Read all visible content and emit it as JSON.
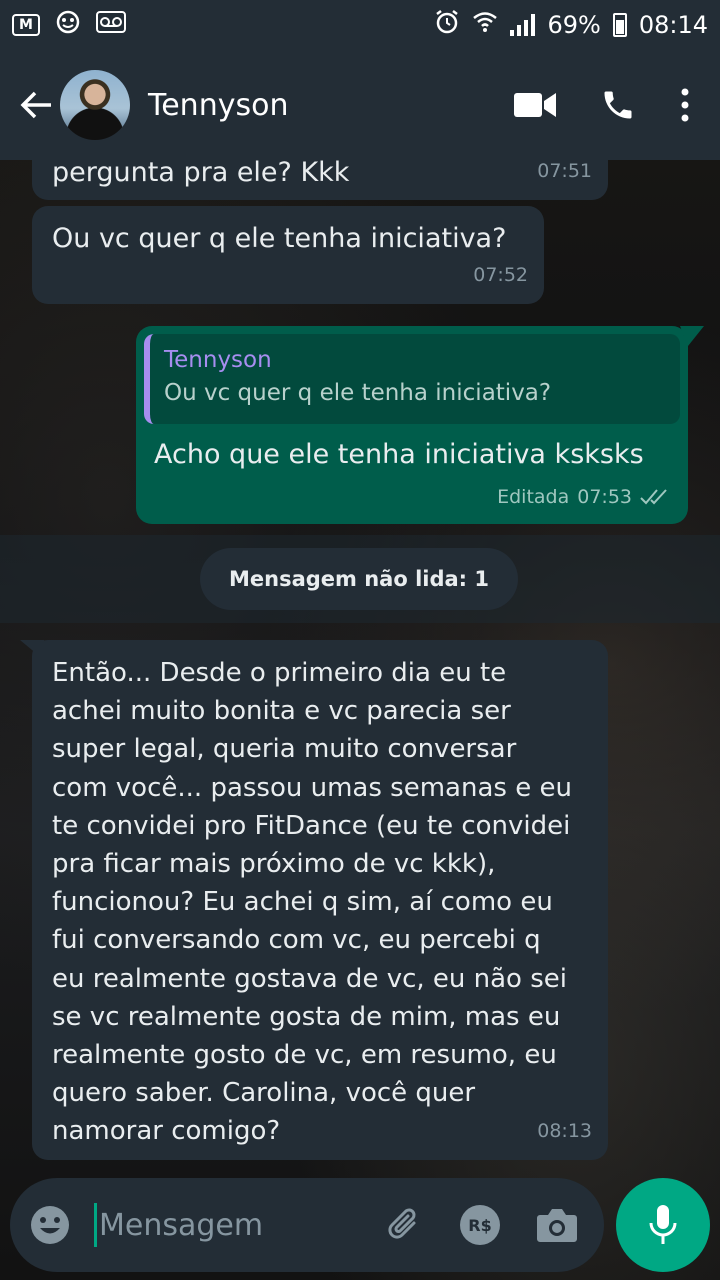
{
  "status_bar": {
    "battery": "69%",
    "time": "08:14",
    "left_icons": [
      "gmail-icon",
      "game-icon",
      "voicemail-icon"
    ]
  },
  "header": {
    "contact_name": "Tennyson"
  },
  "messages": [
    {
      "direction": "in",
      "text": "pergunta pra ele? Kkk",
      "time": "07:51"
    },
    {
      "direction": "in",
      "text": "Ou vc quer q ele tenha iniciativa?",
      "time": "07:52"
    },
    {
      "direction": "out",
      "quote_name": "Tennyson",
      "quote_text": "Ou vc quer q ele tenha iniciativa?",
      "text": "Acho que ele tenha iniciativa ksksks",
      "edited_label": "Editada",
      "time": "07:53"
    },
    {
      "direction": "in",
      "text": "Então... Desde o primeiro dia  eu te achei muito bonita e vc parecia ser super legal, queria muito conversar com você... passou umas semanas e eu te convidei pro FitDance (eu te convidei pra ficar mais próximo de vc kkk), funcionou? Eu achei q sim, aí como eu fui conversando com vc, eu percebi q eu realmente gostava de vc, eu não sei se vc realmente gosta de mim, mas eu realmente gosto de vc, em resumo, eu quero saber. Carolina, você quer namorar comigo?",
      "time": "08:13"
    }
  ],
  "unread": {
    "label": "Mensagem não lida: 1"
  },
  "composer": {
    "placeholder": "Mensagem",
    "payment_label": "R$"
  },
  "colors": {
    "header_bg": "#232d36",
    "incoming_bubble": "#232d36",
    "outgoing_bubble": "#005d4b",
    "accent": "#00a884",
    "quote_name": "#a78ef0"
  }
}
